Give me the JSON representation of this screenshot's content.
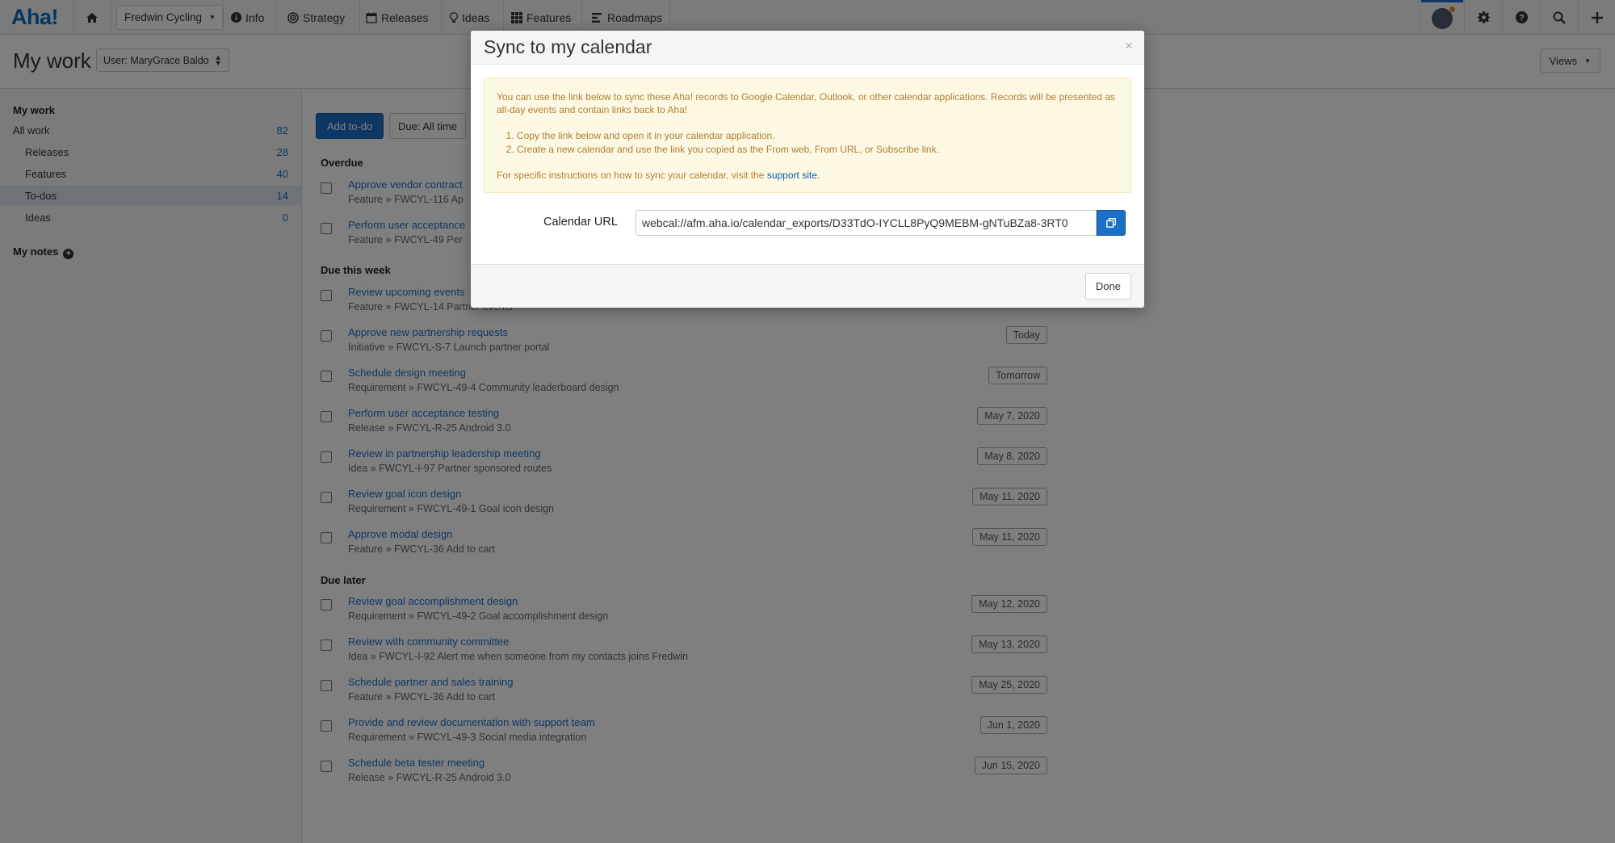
{
  "app": {
    "logo": "Aha!",
    "workspace": "Fredwin Cycling",
    "nav": [
      "Info",
      "Strategy",
      "Releases",
      "Ideas",
      "Features",
      "Roadmaps"
    ]
  },
  "header": {
    "title": "My work",
    "user_filter": "User: MaryGrace Baldo",
    "views": "Views"
  },
  "sidebar": {
    "heading": "My work",
    "items": [
      {
        "label": "All work",
        "count": "82"
      },
      {
        "label": "Releases",
        "count": "28"
      },
      {
        "label": "Features",
        "count": "40"
      },
      {
        "label": "To-dos",
        "count": "14"
      },
      {
        "label": "Ideas",
        "count": "0"
      }
    ],
    "notes": "My notes"
  },
  "main": {
    "add_button": "Add to-do",
    "due_filter": "Due: All time",
    "sections": {
      "overdue": "Overdue",
      "this_week": "Due this week",
      "later": "Due later"
    },
    "todos": [
      {
        "title": "Approve vendor contract",
        "sub": "Feature » FWCYL-116 Ap",
        "date": ""
      },
      {
        "title": "Perform user acceptance",
        "sub": "Feature » FWCYL-49 Per",
        "date": ""
      },
      {
        "title": "Review upcoming events",
        "sub": "Feature » FWCYL-14 Partner events",
        "date": ""
      },
      {
        "title": "Approve new partnership requests",
        "sub": "Initiative » FWCYL-S-7 Launch partner portal",
        "date": "Today"
      },
      {
        "title": "Schedule design meeting",
        "sub": "Requirement » FWCYL-49-4 Community leaderboard design",
        "date": "Tomorrow"
      },
      {
        "title": "Perform user acceptance testing",
        "sub": "Release » FWCYL-R-25 Android 3.0",
        "date": "May 7, 2020"
      },
      {
        "title": "Review in partnership leadership meeting",
        "sub": "Idea » FWCYL-I-97 Partner sponsored routes",
        "date": "May 8, 2020"
      },
      {
        "title": "Review goal icon design",
        "sub": "Requirement » FWCYL-49-1 Goal icon design",
        "date": "May 11, 2020"
      },
      {
        "title": "Approve modal design",
        "sub": "Feature » FWCYL-36 Add to cart",
        "date": "May 11, 2020"
      },
      {
        "title": "Review goal accomplishment design",
        "sub": "Requirement » FWCYL-49-2 Goal accomplishment design",
        "date": "May 12, 2020"
      },
      {
        "title": "Review with community committee",
        "sub": "Idea » FWCYL-I-92 Alert me when someone from my contacts joins Fredwin",
        "date": "May 13, 2020"
      },
      {
        "title": "Schedule partner and sales training",
        "sub": "Feature » FWCYL-36 Add to cart",
        "date": "May 25, 2020"
      },
      {
        "title": "Provide and review documentation with support team",
        "sub": "Requirement » FWCYL-49-3 Social media integration",
        "date": "Jun 1, 2020"
      },
      {
        "title": "Schedule beta tester meeting",
        "sub": "Release » FWCYL-R-25 Android 3.0",
        "date": "Jun 15, 2020"
      }
    ]
  },
  "modal": {
    "title": "Sync to my calendar",
    "close": "×",
    "intro": "You can use the link below to sync these Aha! records to Google Calendar, Outlook, or other calendar applications. Records will be presented as all-day events and contain links back to Aha!",
    "steps": [
      "Copy the link below and open it in your calendar application.",
      "Create a new calendar and use the link you copied as the From web, From URL, or Subscribe link."
    ],
    "instructions_prefix": "For specific instructions on how to sync your calendar, visit the ",
    "support_link": "support site",
    "instructions_suffix": ".",
    "url_label": "Calendar URL",
    "url_value": "webcal://afm.aha.io/calendar_exports/D33TdO-IYCLL8PyQ9MEBM-gNTuBZa8-3RT0",
    "done": "Done"
  },
  "colors": {
    "accent": "#1c6fc7",
    "notice_bg": "#fcf8e4",
    "notice_text": "#b47d2d",
    "notification_dot": "#f08b22"
  }
}
